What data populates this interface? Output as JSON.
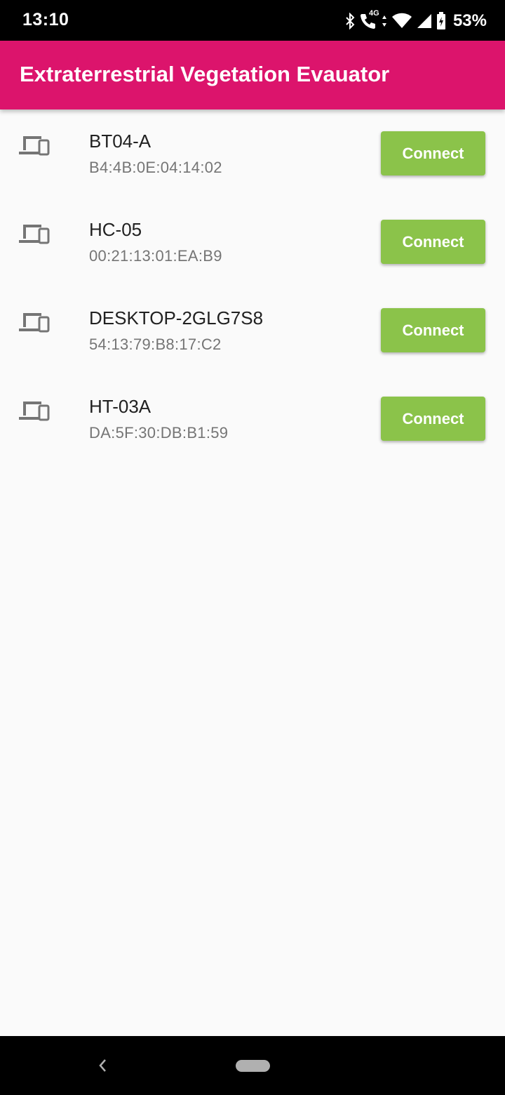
{
  "status_bar": {
    "time": "13:10",
    "icons": [
      "bluetooth-icon",
      "volte-call-icon",
      "4g-data-icon",
      "wifi-icon",
      "cell-signal-icon",
      "battery-icon"
    ],
    "network_label": "4G",
    "battery_percent": "53%"
  },
  "app_bar": {
    "title": "Extraterrestrial Vegetation Evauator",
    "color": "#dc146c"
  },
  "devices": [
    {
      "name": "BT04-A",
      "address": "B4:4B:0E:04:14:02",
      "button_label": "Connect",
      "icon": "devices-icon"
    },
    {
      "name": "HC-05",
      "address": "00:21:13:01:EA:B9",
      "button_label": "Connect",
      "icon": "devices-icon"
    },
    {
      "name": "DESKTOP-2GLG7S8",
      "address": "54:13:79:B8:17:C2",
      "button_label": "Connect",
      "icon": "devices-icon"
    },
    {
      "name": "HT-03A",
      "address": "DA:5F:30:DB:B1:59",
      "button_label": "Connect",
      "icon": "devices-icon"
    }
  ],
  "colors": {
    "accent_button": "#8bc34a",
    "background": "#fafafa"
  },
  "nav_bar": {
    "icons": [
      "back-icon",
      "home-pill-icon"
    ]
  }
}
